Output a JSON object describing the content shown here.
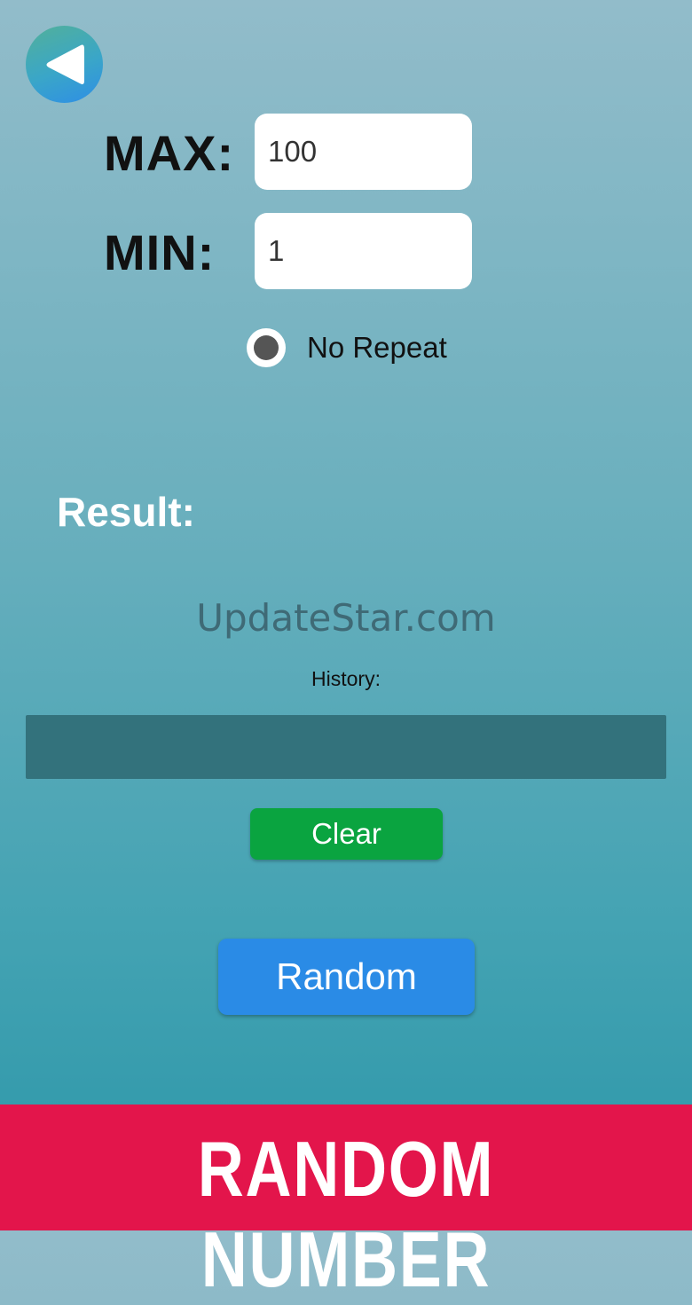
{
  "navigation": {
    "back_icon": "triangle-left-icon"
  },
  "form": {
    "max_label": "MAX:",
    "max_value": "100",
    "min_label": "MIN:",
    "min_value": "1",
    "no_repeat_label": "No Repeat",
    "no_repeat_selected": true
  },
  "result": {
    "label": "Result:",
    "value": ""
  },
  "watermark": "UpdateStar.com",
  "history": {
    "label": "History:",
    "entries": ""
  },
  "buttons": {
    "clear_label": "Clear",
    "random_label": "Random"
  },
  "banner": {
    "text": "RANDOM NUMBER"
  },
  "colors": {
    "banner": "#e3154b",
    "clear_button": "#0aa440",
    "random_button": "#2a8be6",
    "history_box": "#33727c"
  }
}
